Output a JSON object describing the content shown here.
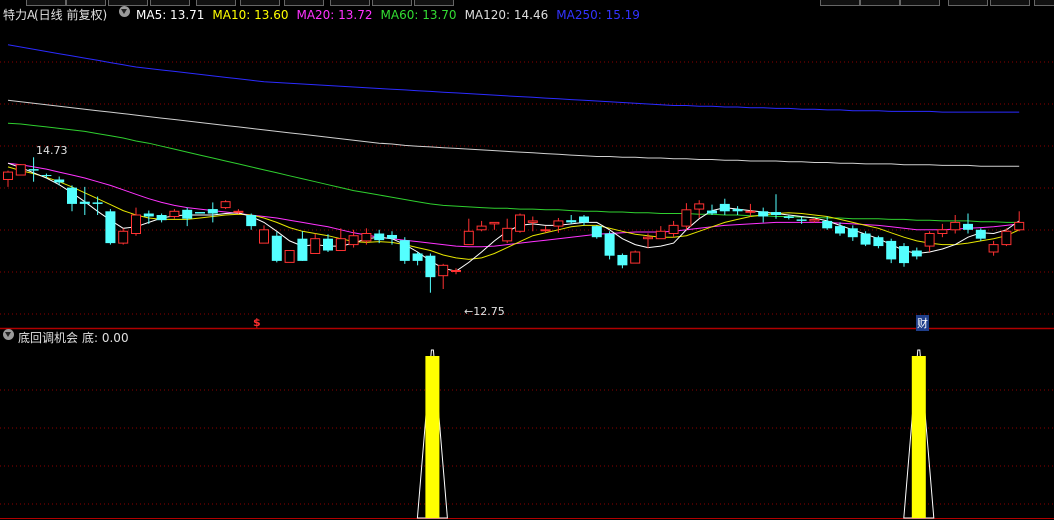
{
  "stock": {
    "name": "特力A",
    "mode": "(日线 前复权)"
  },
  "ma_legend": [
    {
      "label": "MA5: 13.71",
      "color": "#ffffff"
    },
    {
      "label": "MA10: 13.60",
      "color": "#ffff00"
    },
    {
      "label": "MA20: 13.72",
      "color": "#ff33ff"
    },
    {
      "label": "MA60: 13.70",
      "color": "#33dd33"
    },
    {
      "label": "MA120: 14.46",
      "color": "#dddddd"
    },
    {
      "label": "MA250: 15.19",
      "color": "#3333ff"
    }
  ],
  "annotations": {
    "high": "14.73",
    "low": "←12.75",
    "marker_s": "$",
    "marker_cai": "财"
  },
  "indicator": {
    "name": "底回调机会",
    "value": "底: 0.00"
  },
  "colors": {
    "up": "#ff3232",
    "down": "#54ffff",
    "signal": "#ffff00",
    "grid": "#8b0000"
  },
  "chart_data": {
    "type": "candlestick",
    "candles": [
      [
        14.28,
        14.38,
        14.18,
        14.4
      ],
      [
        14.34,
        14.48,
        14.34,
        14.48
      ],
      [
        14.42,
        14.4,
        14.25,
        14.58
      ],
      [
        14.34,
        14.33,
        14.3,
        14.36
      ],
      [
        14.28,
        14.24,
        14.2,
        14.32
      ],
      [
        14.17,
        13.95,
        13.85,
        14.2
      ],
      [
        13.98,
        13.95,
        13.8,
        14.18
      ],
      [
        13.97,
        13.95,
        13.8,
        14.05
      ],
      [
        13.85,
        13.42,
        13.4,
        13.88
      ],
      [
        13.42,
        13.58,
        13.4,
        13.62
      ],
      [
        13.55,
        13.8,
        13.52,
        13.9
      ],
      [
        13.82,
        13.78,
        13.68,
        13.86
      ],
      [
        13.8,
        13.73,
        13.7,
        13.82
      ],
      [
        13.78,
        13.85,
        13.75,
        13.88
      ],
      [
        13.87,
        13.75,
        13.65,
        13.9
      ],
      [
        13.84,
        13.82,
        13.82,
        13.84
      ],
      [
        13.88,
        13.82,
        13.7,
        13.97
      ],
      [
        13.9,
        13.98,
        13.88,
        14.0
      ],
      [
        13.85,
        13.85,
        13.82,
        13.88
      ],
      [
        13.8,
        13.65,
        13.6,
        13.82
      ],
      [
        13.42,
        13.6,
        13.42,
        13.66
      ],
      [
        13.52,
        13.18,
        13.16,
        13.57
      ],
      [
        13.16,
        13.32,
        13.16,
        13.32
      ],
      [
        13.48,
        13.18,
        13.18,
        13.58
      ],
      [
        13.28,
        13.48,
        13.28,
        13.55
      ],
      [
        13.48,
        13.32,
        13.3,
        13.54
      ],
      [
        13.32,
        13.48,
        13.32,
        13.62
      ],
      [
        13.4,
        13.52,
        13.36,
        13.6
      ],
      [
        13.45,
        13.55,
        13.4,
        13.62
      ],
      [
        13.55,
        13.46,
        13.42,
        13.6
      ],
      [
        13.53,
        13.48,
        13.4,
        13.58
      ],
      [
        13.46,
        13.18,
        13.14,
        13.5
      ],
      [
        13.28,
        13.18,
        13.12,
        13.3
      ],
      [
        13.25,
        12.96,
        12.75,
        13.28
      ],
      [
        12.98,
        13.12,
        12.8,
        13.14
      ],
      [
        13.05,
        13.05,
        13.0,
        13.08
      ],
      [
        13.4,
        13.58,
        13.4,
        13.75
      ],
      [
        13.6,
        13.65,
        13.58,
        13.72
      ],
      [
        13.68,
        13.7,
        13.6,
        13.7
      ],
      [
        13.45,
        13.62,
        13.42,
        13.75
      ],
      [
        13.58,
        13.8,
        13.56,
        13.82
      ],
      [
        13.7,
        13.72,
        13.58,
        13.78
      ],
      [
        13.6,
        13.6,
        13.56,
        13.65
      ],
      [
        13.65,
        13.72,
        13.56,
        13.76
      ],
      [
        13.73,
        13.7,
        13.68,
        13.8
      ],
      [
        13.78,
        13.7,
        13.66,
        13.8
      ],
      [
        13.65,
        13.5,
        13.48,
        13.66
      ],
      [
        13.55,
        13.25,
        13.2,
        13.58
      ],
      [
        13.26,
        13.12,
        13.08,
        13.28
      ],
      [
        13.15,
        13.3,
        13.15,
        13.32
      ],
      [
        13.48,
        13.5,
        13.35,
        13.55
      ],
      [
        13.48,
        13.58,
        13.48,
        13.65
      ],
      [
        13.55,
        13.66,
        13.5,
        13.72
      ],
      [
        13.65,
        13.87,
        13.6,
        13.96
      ],
      [
        13.88,
        13.95,
        13.76,
        14.0
      ],
      [
        13.86,
        13.82,
        13.8,
        13.94
      ],
      [
        13.95,
        13.85,
        13.8,
        14.02
      ],
      [
        13.88,
        13.85,
        13.8,
        13.92
      ],
      [
        13.85,
        13.85,
        13.78,
        13.95
      ],
      [
        13.85,
        13.78,
        13.7,
        13.9
      ],
      [
        13.84,
        13.8,
        13.75,
        14.08
      ],
      [
        13.78,
        13.76,
        13.74,
        13.8
      ],
      [
        13.74,
        13.72,
        13.68,
        13.78
      ],
      [
        13.72,
        13.74,
        13.7,
        13.76
      ],
      [
        13.72,
        13.62,
        13.6,
        13.78
      ],
      [
        13.65,
        13.55,
        13.52,
        13.7
      ],
      [
        13.62,
        13.5,
        13.45,
        13.66
      ],
      [
        13.55,
        13.4,
        13.38,
        13.58
      ],
      [
        13.5,
        13.38,
        13.35,
        13.52
      ],
      [
        13.45,
        13.2,
        13.15,
        13.48
      ],
      [
        13.38,
        13.15,
        13.1,
        13.42
      ],
      [
        13.32,
        13.24,
        13.2,
        13.36
      ],
      [
        13.38,
        13.55,
        13.3,
        13.58
      ],
      [
        13.55,
        13.6,
        13.5,
        13.68
      ],
      [
        13.6,
        13.7,
        13.55,
        13.8
      ],
      [
        13.68,
        13.6,
        13.55,
        13.82
      ],
      [
        13.6,
        13.48,
        13.45,
        13.62
      ],
      [
        13.3,
        13.4,
        13.25,
        13.45
      ],
      [
        13.4,
        13.58,
        13.38,
        13.62
      ],
      [
        13.6,
        13.7,
        13.58,
        13.85
      ]
    ],
    "ma5": [
      14.5,
      14.44,
      14.37,
      14.3,
      14.21,
      14.1,
      13.98,
      13.85,
      13.73,
      13.62,
      13.64,
      13.7,
      13.76,
      13.79,
      13.8,
      13.8,
      13.8,
      13.82,
      13.83,
      13.78,
      13.7,
      13.58,
      13.45,
      13.38,
      13.4,
      13.38,
      13.38,
      13.42,
      13.48,
      13.5,
      13.48,
      13.4,
      13.3,
      13.18,
      13.08,
      13.04,
      13.16,
      13.3,
      13.45,
      13.58,
      13.66,
      13.68,
      13.66,
      13.66,
      13.68,
      13.7,
      13.7,
      13.6,
      13.48,
      13.4,
      13.36,
      13.38,
      13.42,
      13.6,
      13.75,
      13.86,
      13.9,
      13.88,
      13.86,
      13.84,
      13.82,
      13.8,
      13.78,
      13.76,
      13.72,
      13.66,
      13.6,
      13.54,
      13.48,
      13.4,
      13.32,
      13.28,
      13.3,
      13.34,
      13.4,
      13.5,
      13.56,
      13.55,
      13.6,
      13.72
    ],
    "ma10": [
      14.45,
      14.4,
      14.36,
      14.31,
      14.25,
      14.18,
      14.1,
      14.02,
      13.94,
      13.86,
      13.8,
      13.76,
      13.74,
      13.74,
      13.74,
      13.76,
      13.78,
      13.8,
      13.81,
      13.8,
      13.76,
      13.7,
      13.63,
      13.58,
      13.55,
      13.52,
      13.48,
      13.44,
      13.43,
      13.44,
      13.43,
      13.4,
      13.36,
      13.32,
      13.26,
      13.22,
      13.2,
      13.22,
      13.28,
      13.36,
      13.44,
      13.52,
      13.56,
      13.6,
      13.64,
      13.66,
      13.66,
      13.62,
      13.58,
      13.54,
      13.52,
      13.5,
      13.5,
      13.52,
      13.58,
      13.64,
      13.7,
      13.74,
      13.78,
      13.8,
      13.82,
      13.83,
      13.82,
      13.8,
      13.78,
      13.74,
      13.7,
      13.66,
      13.62,
      13.56,
      13.5,
      13.45,
      13.42,
      13.4,
      13.4,
      13.42,
      13.45,
      13.48,
      13.52,
      13.6
    ],
    "ma20": [
      14.5,
      14.48,
      14.45,
      14.42,
      14.38,
      14.34,
      14.3,
      14.25,
      14.2,
      14.14,
      14.08,
      14.02,
      13.97,
      13.93,
      13.9,
      13.88,
      13.86,
      13.84,
      13.82,
      13.8,
      13.78,
      13.76,
      13.73,
      13.7,
      13.67,
      13.64,
      13.6,
      13.56,
      13.53,
      13.5,
      13.48,
      13.46,
      13.44,
      13.42,
      13.4,
      13.38,
      13.37,
      13.37,
      13.38,
      13.4,
      13.42,
      13.44,
      13.46,
      13.48,
      13.5,
      13.52,
      13.54,
      13.55,
      13.56,
      13.57,
      13.57,
      13.57,
      13.58,
      13.6,
      13.62,
      13.64,
      13.66,
      13.67,
      13.68,
      13.69,
      13.7,
      13.7,
      13.7,
      13.7,
      13.7,
      13.69,
      13.68,
      13.67,
      13.66,
      13.64,
      13.62,
      13.6,
      13.6,
      13.6,
      13.61,
      13.62,
      13.63,
      13.64,
      13.66,
      13.68
    ],
    "ma60": [
      15.04,
      15.03,
      15.01,
      14.99,
      14.97,
      14.95,
      14.93,
      14.9,
      14.87,
      14.84,
      14.8,
      14.77,
      14.73,
      14.69,
      14.65,
      14.61,
      14.57,
      14.53,
      14.49,
      14.45,
      14.41,
      14.37,
      14.33,
      14.29,
      14.25,
      14.21,
      14.17,
      14.13,
      14.1,
      14.07,
      14.04,
      14.01,
      13.98,
      13.95,
      13.93,
      13.92,
      13.91,
      13.9,
      13.89,
      13.89,
      13.88,
      13.88,
      13.87,
      13.87,
      13.86,
      13.85,
      13.85,
      13.84,
      13.84,
      13.83,
      13.83,
      13.82,
      13.82,
      13.82,
      13.81,
      13.81,
      13.8,
      13.8,
      13.79,
      13.79,
      13.78,
      13.78,
      13.77,
      13.77,
      13.76,
      13.76,
      13.75,
      13.75,
      13.75,
      13.74,
      13.74,
      13.73,
      13.73,
      13.72,
      13.72,
      13.72,
      13.71,
      13.71,
      13.7,
      13.7
    ],
    "ma120": [
      15.35,
      15.33,
      15.31,
      15.29,
      15.27,
      15.25,
      15.23,
      15.21,
      15.19,
      15.17,
      15.15,
      15.13,
      15.11,
      15.09,
      15.07,
      15.05,
      15.03,
      15.01,
      14.99,
      14.97,
      14.95,
      14.93,
      14.91,
      14.89,
      14.87,
      14.85,
      14.83,
      14.81,
      14.79,
      14.77,
      14.76,
      14.74,
      14.73,
      14.72,
      14.71,
      14.7,
      14.69,
      14.68,
      14.67,
      14.66,
      14.65,
      14.64,
      14.63,
      14.62,
      14.61,
      14.6,
      14.59,
      14.59,
      14.58,
      14.58,
      14.57,
      14.57,
      14.56,
      14.56,
      14.55,
      14.55,
      14.54,
      14.54,
      14.53,
      14.53,
      14.53,
      14.52,
      14.52,
      14.51,
      14.51,
      14.5,
      14.5,
      14.49,
      14.49,
      14.49,
      14.48,
      14.48,
      14.48,
      14.47,
      14.47,
      14.47,
      14.46,
      14.46,
      14.46,
      14.46
    ],
    "ma250": [
      16.1,
      16.07,
      16.04,
      16.01,
      15.98,
      15.95,
      15.92,
      15.89,
      15.86,
      15.83,
      15.8,
      15.78,
      15.76,
      15.74,
      15.72,
      15.7,
      15.68,
      15.66,
      15.64,
      15.62,
      15.6,
      15.59,
      15.58,
      15.57,
      15.56,
      15.55,
      15.54,
      15.53,
      15.52,
      15.51,
      15.5,
      15.49,
      15.48,
      15.47,
      15.46,
      15.45,
      15.44,
      15.43,
      15.42,
      15.41,
      15.4,
      15.39,
      15.38,
      15.37,
      15.36,
      15.35,
      15.34,
      15.33,
      15.32,
      15.31,
      15.3,
      15.29,
      15.28,
      15.28,
      15.27,
      15.27,
      15.26,
      15.26,
      15.25,
      15.25,
      15.24,
      15.24,
      15.23,
      15.23,
      15.22,
      15.22,
      15.21,
      15.21,
      15.21,
      15.2,
      15.2,
      15.2,
      15.2,
      15.19,
      15.19,
      15.19,
      15.19,
      15.19,
      15.19,
      15.19
    ],
    "price_range": [
      12.3,
      16.3
    ],
    "signals": [
      33,
      71
    ],
    "indicator_range": [
      0,
      1
    ]
  }
}
